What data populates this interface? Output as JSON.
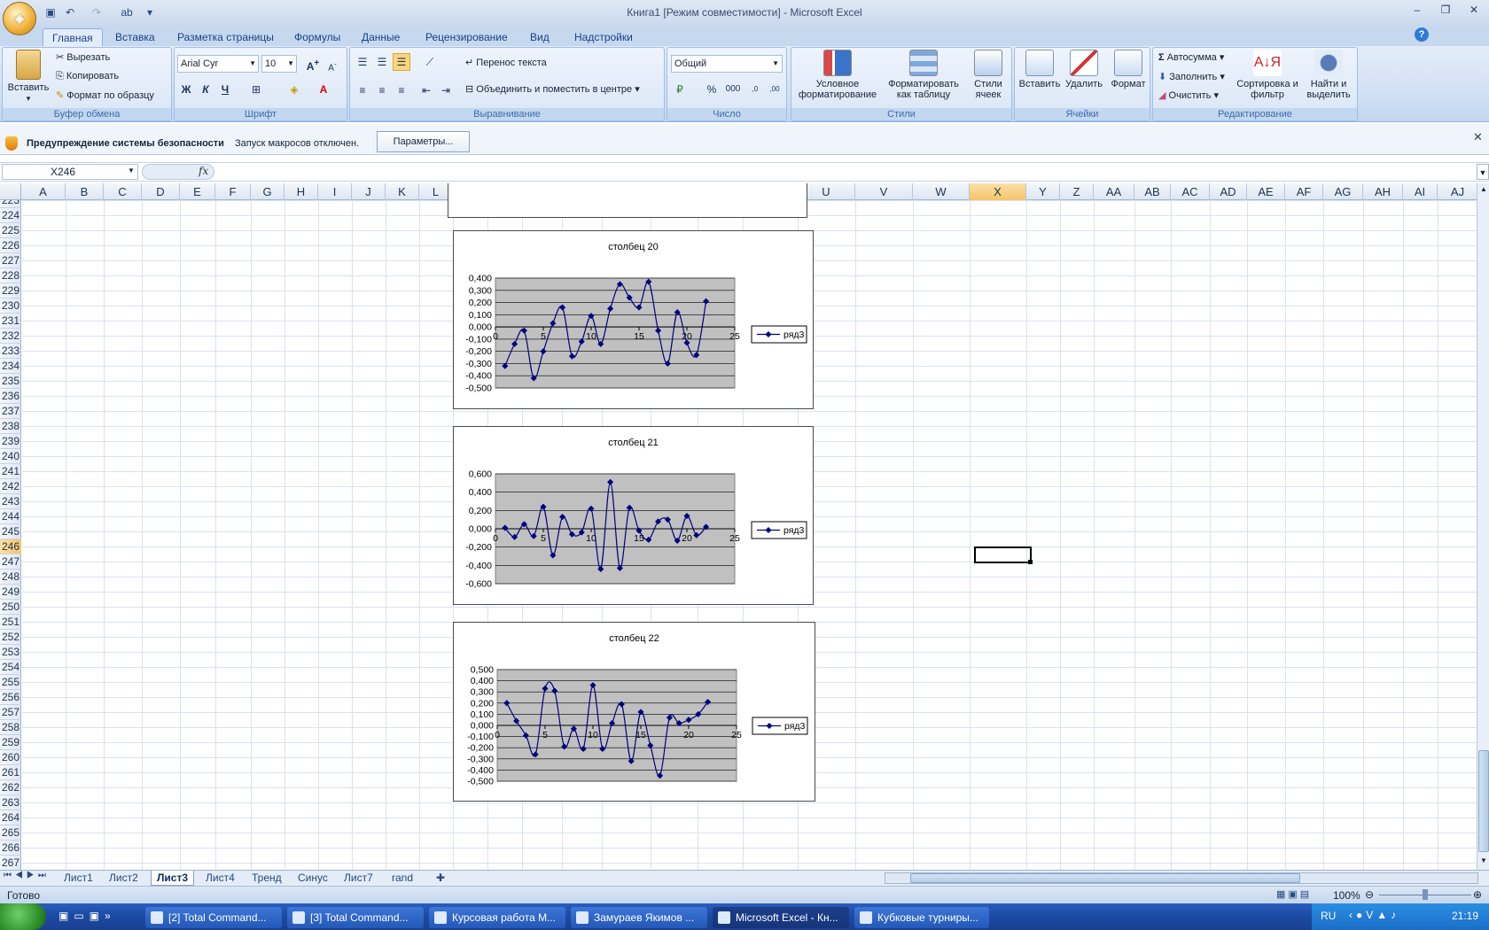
{
  "window": {
    "title": "Книга1  [Режим совместимости] - Microsoft Excel"
  },
  "qat": [
    "save-icon",
    "undo-icon",
    "redo-icon",
    "spelling-icon"
  ],
  "tabs": [
    "Главная",
    "Вставка",
    "Разметка страницы",
    "Формулы",
    "Данные",
    "Рецензирование",
    "Вид",
    "Надстройки"
  ],
  "clipboard": {
    "paste": "Вставить",
    "cut": "Вырезать",
    "copy": "Копировать",
    "format_painter": "Формат по образцу",
    "label": "Буфер обмена"
  },
  "font": {
    "name": "Arial Cyr",
    "size": "10",
    "bold": "Ж",
    "italic": "К",
    "underline": "Ч",
    "label": "Шрифт"
  },
  "alignment": {
    "wrap": "Перенос текста",
    "merge": "Объединить и поместить в центре",
    "label": "Выравнивание"
  },
  "number": {
    "format": "Общий",
    "percent": "%",
    "thousands": "000",
    "label": "Число",
    "inc": ",0 ,00",
    "dec": ",00 ,0"
  },
  "styles": {
    "conditional": "Условное форматирование",
    "as_table": "Форматировать как таблицу",
    "cell_styles": "Стили ячеек",
    "label": "Стили"
  },
  "cells": {
    "insert": "Вставить",
    "delete": "Удалить",
    "format": "Формат",
    "label": "Ячейки"
  },
  "editing": {
    "autosum": "Автосумма",
    "fill": "Заполнить",
    "clear": "Очистить",
    "sort": "Сортировка и фильтр",
    "find": "Найти и выделить",
    "label": "Редактирование"
  },
  "security": {
    "title": "Предупреждение системы безопасности",
    "message": "Запуск макросов отключен.",
    "button": "Параметры..."
  },
  "formula": {
    "namebox": "X246",
    "fx": "fx",
    "value": ""
  },
  "columns": [
    "A",
    "B",
    "C",
    "D",
    "E",
    "F",
    "G",
    "H",
    "I",
    "J",
    "K",
    "L",
    "M",
    "N",
    "O",
    "P",
    "Q",
    "R",
    "S",
    "T",
    "U",
    "V",
    "W",
    "X",
    "Y",
    "Z",
    "AA",
    "AB",
    "AC",
    "AD",
    "AE",
    "AF",
    "AG",
    "AH",
    "AI",
    "AJ"
  ],
  "rows": [
    "223",
    "224",
    "225",
    "226",
    "227",
    "228",
    "229",
    "230",
    "231",
    "232",
    "233",
    "234",
    "235",
    "236",
    "237",
    "238",
    "239",
    "240",
    "241",
    "242",
    "243",
    "244",
    "245",
    "246",
    "247",
    "248",
    "249",
    "250",
    "251",
    "252",
    "253",
    "254",
    "255",
    "256",
    "257",
    "258",
    "259",
    "260",
    "261",
    "262",
    "263",
    "264",
    "265",
    "266",
    "267"
  ],
  "selected_cell": {
    "col": "X",
    "row": "246"
  },
  "chart_data": [
    {
      "type": "line",
      "title": "столбец 20",
      "legend": "ряд3",
      "legend_position": "right",
      "x_ticks": [
        "0",
        "5",
        "10",
        "15",
        "20",
        "25"
      ],
      "y_ticks": [
        "0,400",
        "0,300",
        "0,200",
        "0,100",
        "0,000",
        "-0,100",
        "-0,200",
        "-0,300",
        "-0,400",
        "-0,500"
      ],
      "ylim": [
        -0.5,
        0.4
      ],
      "xlim": [
        0,
        25
      ],
      "x": [
        1,
        2,
        3,
        4,
        5,
        6,
        7,
        8,
        9,
        10,
        11,
        12,
        13,
        14,
        15,
        16,
        17,
        18,
        19,
        20,
        21,
        22
      ],
      "values": [
        -0.32,
        -0.14,
        -0.03,
        -0.42,
        -0.2,
        0.03,
        0.16,
        -0.24,
        -0.12,
        0.09,
        -0.14,
        0.15,
        0.35,
        0.24,
        0.16,
        0.37,
        -0.03,
        -0.3,
        0.12,
        -0.13,
        -0.23,
        0.21
      ]
    },
    {
      "type": "line",
      "title": "столбец 21",
      "legend": "ряд3",
      "legend_position": "right",
      "x_ticks": [
        "0",
        "5",
        "10",
        "15",
        "20",
        "25"
      ],
      "y_ticks": [
        "0,600",
        "0,400",
        "0,200",
        "0,000",
        "-0,200",
        "-0,400",
        "-0,600"
      ],
      "ylim": [
        -0.6,
        0.6
      ],
      "xlim": [
        0,
        25
      ],
      "x": [
        1,
        2,
        3,
        4,
        5,
        6,
        7,
        8,
        9,
        10,
        11,
        12,
        13,
        14,
        15,
        16,
        17,
        18,
        19,
        20,
        21,
        22
      ],
      "values": [
        0.01,
        -0.09,
        0.05,
        -0.08,
        0.24,
        -0.29,
        0.13,
        -0.06,
        -0.04,
        0.22,
        -0.44,
        0.51,
        -0.43,
        0.23,
        -0.02,
        -0.12,
        0.08,
        0.1,
        -0.13,
        0.14,
        -0.07,
        0.02
      ]
    },
    {
      "type": "line",
      "title": "столбец 22",
      "legend": "ряд3",
      "legend_position": "right",
      "x_ticks": [
        "0",
        "5",
        "10",
        "15",
        "20",
        "25"
      ],
      "y_ticks": [
        "0,500",
        "0,400",
        "0,300",
        "0,200",
        "0,100",
        "0,000",
        "-0,100",
        "-0,200",
        "-0,300",
        "-0,400",
        "-0,500"
      ],
      "ylim": [
        -0.5,
        0.5
      ],
      "xlim": [
        0,
        25
      ],
      "x": [
        1,
        2,
        3,
        4,
        5,
        6,
        7,
        8,
        9,
        10,
        11,
        12,
        13,
        14,
        15,
        16,
        17,
        18,
        19,
        20,
        21,
        22
      ],
      "values": [
        0.2,
        0.04,
        -0.09,
        -0.26,
        0.33,
        0.31,
        -0.19,
        -0.03,
        -0.21,
        0.36,
        -0.21,
        0.02,
        0.19,
        -0.32,
        0.12,
        -0.18,
        -0.45,
        0.07,
        0.02,
        0.05,
        0.1,
        0.21
      ]
    }
  ],
  "sheets": [
    "Лист1",
    "Лист2",
    "Лист3",
    "Лист4",
    "Тренд",
    "Синус",
    "Лист7",
    "rand"
  ],
  "active_sheet": "Лист3",
  "status": {
    "ready": "Готово",
    "zoom": "100%"
  },
  "taskbar": {
    "items": [
      "[2] Total Command...",
      "[3] Total Command...",
      "Курсовая работа М...",
      "Замураев Якимов ...",
      "Microsoft Excel - Кн...",
      "Кубковые турниры..."
    ],
    "lang": "RU",
    "time": "21:19"
  }
}
